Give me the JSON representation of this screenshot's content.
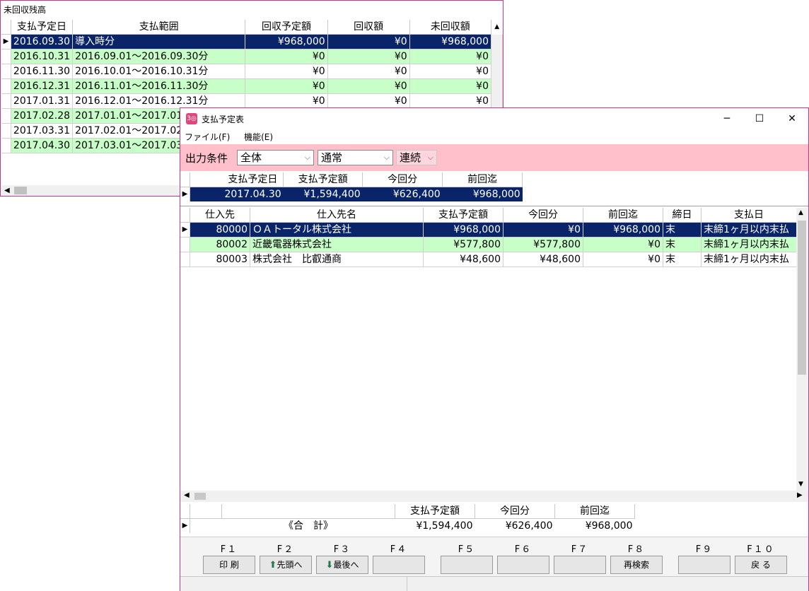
{
  "back_window": {
    "title": "未回収残高",
    "columns": [
      "支払予定日",
      "支払範囲",
      "回収予定額",
      "回収額",
      "未回収額"
    ],
    "rows": [
      [
        "2016.09.30",
        "導入時分",
        "¥968,000",
        "¥0",
        "¥968,000"
      ],
      [
        "2016.10.31",
        "2016.09.01～2016.09.30分",
        "¥0",
        "¥0",
        "¥0"
      ],
      [
        "2016.11.30",
        "2016.10.01～2016.10.31分",
        "¥0",
        "¥0",
        "¥0"
      ],
      [
        "2016.12.31",
        "2016.11.01～2016.11.30分",
        "¥0",
        "¥0",
        "¥0"
      ],
      [
        "2017.01.31",
        "2016.12.01～2016.12.31分",
        "¥0",
        "¥0",
        "¥0"
      ],
      [
        "2017.02.28",
        "2017.01.01～2017.01",
        "",
        "",
        ""
      ],
      [
        "2017.03.31",
        "2017.02.01～2017.02",
        "",
        "",
        ""
      ],
      [
        "2017.04.30",
        "2017.03.01～2017.03",
        "",
        "",
        ""
      ]
    ]
  },
  "front_window": {
    "app_icon_text": "3◎",
    "title": "支払予定表",
    "controls": {
      "minimize": "─",
      "maximize": "☐",
      "close": "✕"
    },
    "menu": [
      "ファイル(F)",
      "機能(E)"
    ],
    "conditions": {
      "label": "出力条件",
      "select1": "全体",
      "select2": "通常",
      "select3": "連続"
    },
    "summary": {
      "columns": [
        "支払予定日",
        "支払予定額",
        "今回分",
        "前回迄"
      ],
      "row": [
        "2017.04.30",
        "¥1,594,400",
        "¥626,400",
        "¥968,000"
      ]
    },
    "main_grid": {
      "columns": [
        "仕入先",
        "仕入先名",
        "支払予定額",
        "今回分",
        "前回迄",
        "締日",
        "支払日"
      ],
      "rows": [
        [
          "80000",
          "ＯＡトータル株式会社",
          "¥968,000",
          "¥0",
          "¥968,000",
          "末",
          "末締1ヶ月以内末払"
        ],
        [
          "80002",
          "近畿電器株式会社",
          "¥577,800",
          "¥577,800",
          "¥0",
          "末",
          "末締1ヶ月以内末払"
        ],
        [
          "80003",
          "株式会社　比叡通商",
          "¥48,600",
          "¥48,600",
          "¥0",
          "末",
          "末締1ヶ月以内末払"
        ]
      ]
    },
    "totals": {
      "columns": [
        "支払予定額",
        "今回分",
        "前回迄"
      ],
      "label": "《合　計》",
      "values": [
        "¥1,594,400",
        "¥626,400",
        "¥968,000"
      ]
    },
    "fkeys": [
      {
        "key": "F１",
        "label": "印 刷"
      },
      {
        "key": "F２",
        "label": "先頭へ",
        "icon": "arrow-up-icon"
      },
      {
        "key": "F３",
        "label": "最後へ",
        "icon": "arrow-down-icon"
      },
      {
        "key": "F４",
        "label": ""
      },
      {
        "key": "F５",
        "label": ""
      },
      {
        "key": "F６",
        "label": ""
      },
      {
        "key": "F７",
        "label": ""
      },
      {
        "key": "F８",
        "label": "再検索"
      },
      {
        "key": "F９",
        "label": ""
      },
      {
        "key": "F１０",
        "label": "戻 る"
      }
    ],
    "colors": {
      "selected": "#0a246a",
      "green_row": "#c8ffc8",
      "condition_bar": "#ffc0cb",
      "border": "#c0398a"
    }
  }
}
